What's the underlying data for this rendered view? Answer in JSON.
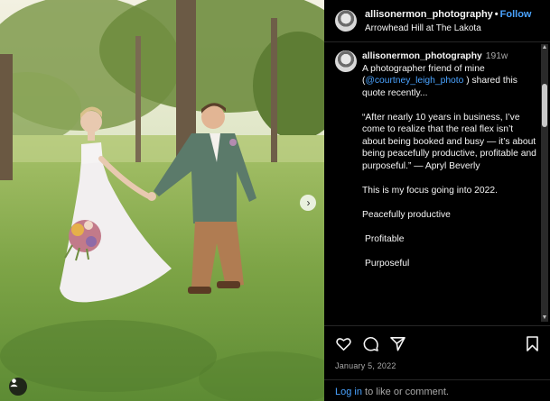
{
  "header": {
    "username": "allisonermon_photography",
    "separator": "•",
    "follow_label": "Follow",
    "location": "Arrowhead Hill at The Lakota"
  },
  "caption": {
    "username": "allisonermon_photography",
    "time_ago": "191w",
    "line1_before": "A photographer friend of mine (",
    "mention": "@courtney_leigh_photo",
    "line1_after": " ) shared this quote recently...",
    "quote": "“After nearly 10 years in business, I’ve come to realize that the real flex isn’t about being booked and busy — it’s about being peacefully productive, profitable and purposeful.” — Apryl Beverly",
    "focus": "This is my focus going into 2022.",
    "item1": "Peacefully productive",
    "item2": "Profitable",
    "item3": "Purposeful"
  },
  "actions": {
    "icons": [
      "heart-icon",
      "comment-icon",
      "share-icon",
      "bookmark-icon"
    ]
  },
  "date": "January 5, 2022",
  "login": {
    "link": "Log in",
    "text": " to like or comment."
  },
  "photo": {
    "icons": [
      "chevron-right-icon",
      "user-tag-icon"
    ]
  },
  "colors": {
    "link": "#4aa3ff",
    "background": "#000000",
    "muted": "#a8a8a8"
  }
}
